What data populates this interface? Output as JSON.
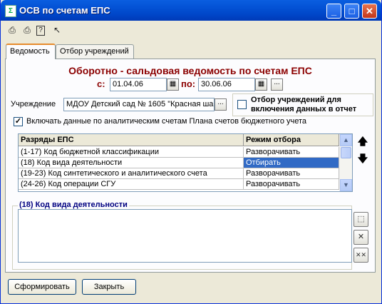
{
  "window": {
    "title": "ОСВ по счетам ЕПС",
    "minimize": "_",
    "maximize": "□",
    "close": "✕"
  },
  "tabs": [
    "Ведомость",
    "Отбор учреждений"
  ],
  "heading": "Оборотно - сальдовая ведомость по счетам ЕПС",
  "period": {
    "from_label": "с:",
    "from_value": "01.04.06",
    "to_label": "по:",
    "to_value": "30.06.06"
  },
  "institution": {
    "label": "Учреждение",
    "value": "МДОУ Детский сад № 1605 \"Красная ша",
    "button": "...",
    "filter_checkbox_label": "Отбор учреждений для включения данных в отчет",
    "filter_checked": false
  },
  "include_analytics": {
    "label": "Включать данные по аналитическим счетам Плана счетов бюджетного учета",
    "checked": true
  },
  "grid": {
    "columns": [
      "Разряды ЕПС",
      "Режим отбора"
    ],
    "rows": [
      [
        "(1-17) Код бюджетной классификации",
        "Разворачивать"
      ],
      [
        "(18) Код вида деятельности",
        "Отбирать"
      ],
      [
        "(19-23) Код синтетического и аналитического счета",
        "Разворачивать"
      ],
      [
        "(24-26) Код операции СГУ",
        "Разворачивать"
      ]
    ],
    "selected_row": 1
  },
  "detail": {
    "title": "(18) Код вида деятельности"
  },
  "buttons": {
    "generate": "Сформировать",
    "close": "Закрыть"
  }
}
